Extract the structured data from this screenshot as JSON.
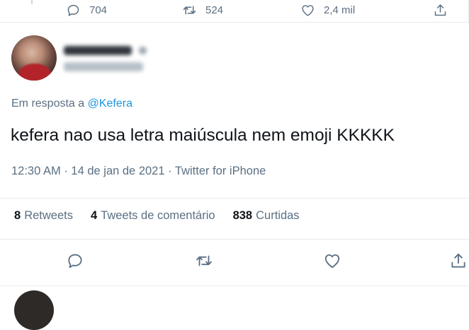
{
  "previous_tweet": {
    "reply_count": "704",
    "retweet_count": "524",
    "like_count": "2,4 mil"
  },
  "tweet": {
    "reply_prefix": "Em resposta a",
    "reply_handle": "@Kefera",
    "text": "kefera nao usa letra maiúscula nem emoji KKKKK",
    "time": "12:30 AM",
    "date": "14 de jan de 2021",
    "source": "Twitter for iPhone",
    "separator": "·"
  },
  "stats": {
    "retweets_count": "8",
    "retweets_label": "Retweets",
    "quotes_count": "4",
    "quotes_label": "Tweets de comentário",
    "likes_count": "838",
    "likes_label": "Curtidas"
  },
  "icons": {
    "reply": "reply-icon",
    "retweet": "retweet-icon",
    "like": "heart-icon",
    "share": "share-icon"
  },
  "colors": {
    "link": "#1b95e0",
    "secondary_text": "#5b7083",
    "primary_text": "#0f1419",
    "divider": "#e6ecf0"
  }
}
